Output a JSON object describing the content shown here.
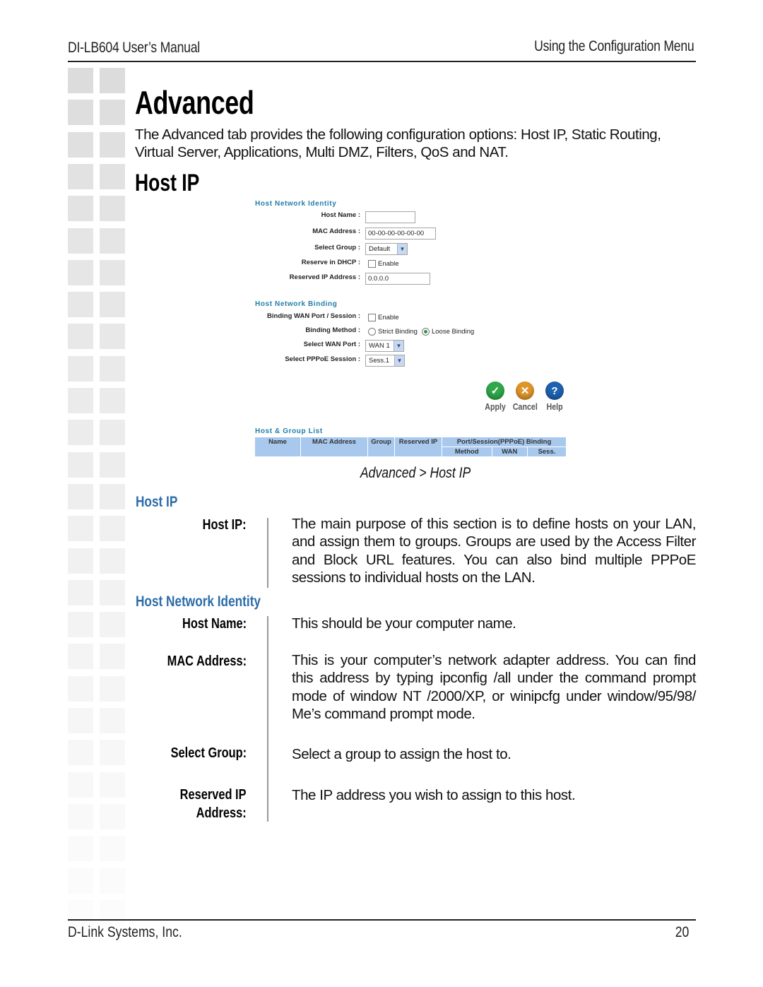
{
  "header": {
    "left": "DI-LB604 User’s Manual",
    "right": "Using the Configuration Menu"
  },
  "title": "Advanced",
  "intro": "The Advanced tab provides the following configuration options: Host IP, Static Routing, Virtual Server, Applications, Multi DMZ, Filters, QoS and NAT.",
  "subtitle": "Host IP",
  "screenshot": {
    "identity": {
      "heading": "Host Network Identity",
      "host_name_label": "Host Name :",
      "host_name_value": "",
      "mac_label": "MAC Address :",
      "mac_value": "00-00-00-00-00-00",
      "group_label": "Select Group :",
      "group_value": "Default",
      "dhcp_label": "Reserve in DHCP :",
      "dhcp_option": "Enable",
      "dhcp_checked": false,
      "reserved_ip_label": "Reserved IP Address :",
      "reserved_ip_value": "0.0.0.0"
    },
    "binding": {
      "heading": "Host Network Binding",
      "port_session_label": "Binding WAN Port / Session :",
      "port_session_option": "Enable",
      "port_session_checked": false,
      "method_label": "Binding Method :",
      "method_options": [
        "Strict Binding",
        "Loose Binding"
      ],
      "method_selected": "Loose Binding",
      "wan_label": "Select WAN Port :",
      "wan_value": "WAN 1",
      "pppoe_label": "Select PPPoE Session :",
      "pppoe_value": "Sess.1"
    },
    "buttons": {
      "apply": "Apply",
      "cancel": "Cancel",
      "help": "Help"
    },
    "list": {
      "heading": "Host & Group List",
      "columns": [
        "Name",
        "MAC Address",
        "Group",
        "Reserved IP"
      ],
      "group_column": "Port/Session(PPPoE) Binding",
      "sub_columns": [
        "Method",
        "WAN",
        "Sess."
      ]
    }
  },
  "caption": "Advanced > Host IP",
  "sections": [
    {
      "heading": "Host IP",
      "items": [
        {
          "term": "Host IP:",
          "desc": "The main purpose of this section is to define hosts on your LAN, and assign them to groups. Groups are used by the Access Filter and Block URL features. You can also bind multiple PPPoE sessions to individual hosts on the LAN."
        }
      ]
    },
    {
      "heading": "Host Network Identity",
      "items": [
        {
          "term": "Host Name:",
          "desc": "This should be your computer name."
        },
        {
          "term": "MAC Address:",
          "desc": "This is your computer’s network adapter address. You can find this address by typing ipconfig /all under the command prompt mode of window NT /2000/XP, or winipcfg under window/95/98/ Me’s command prompt mode."
        },
        {
          "term": "Select Group:",
          "desc": "Select a group to assign the host to."
        },
        {
          "term": "Reserved IP Address:",
          "term_line1": "Reserved IP",
          "term_line2": "Address:",
          "desc": "The IP address you wish to assign to this host."
        }
      ]
    }
  ],
  "footer": {
    "left": "D-Link Systems, Inc.",
    "page": "20"
  },
  "colors": {
    "section_heading": "#2b6ca8",
    "screenshot_heading": "#1f7ea8",
    "table_header": "#a8c8ee",
    "apply": "#2fa84a",
    "cancel": "#e0952a",
    "help": "#1f62b0"
  }
}
